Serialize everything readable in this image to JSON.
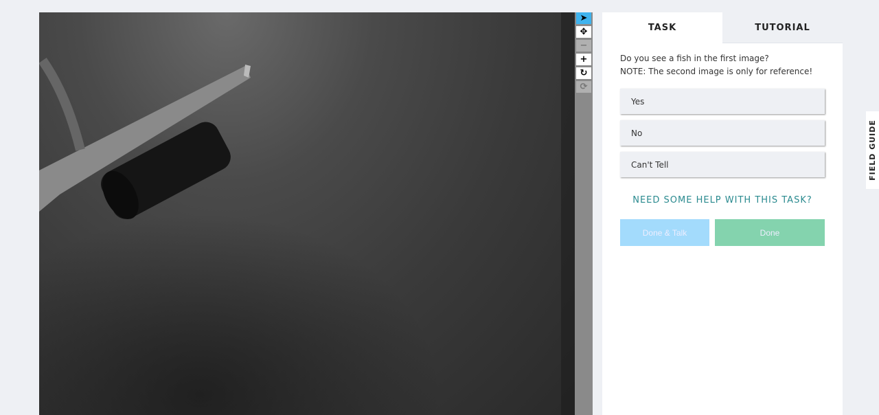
{
  "toolbar": {
    "tools": [
      "pointer",
      "pan",
      "zoom-out",
      "zoom-in",
      "rotate",
      "reset"
    ]
  },
  "tabs": {
    "task": "TASK",
    "tutorial": "TUTORIAL"
  },
  "task": {
    "question": "Do you see a fish in the first image?",
    "note": "NOTE: The second image is only for reference!",
    "answers": [
      "Yes",
      "No",
      "Can't Tell"
    ],
    "help": "NEED SOME HELP WITH THIS TASK?",
    "done_talk": "Done & Talk",
    "done": "Done"
  },
  "colors": {
    "done_talk": "#a3dbfc",
    "done": "#84d3ae",
    "help": "#2a8a8f",
    "active_tool": "#3fb3ee"
  },
  "field_guide": "FIELD GUIDE"
}
